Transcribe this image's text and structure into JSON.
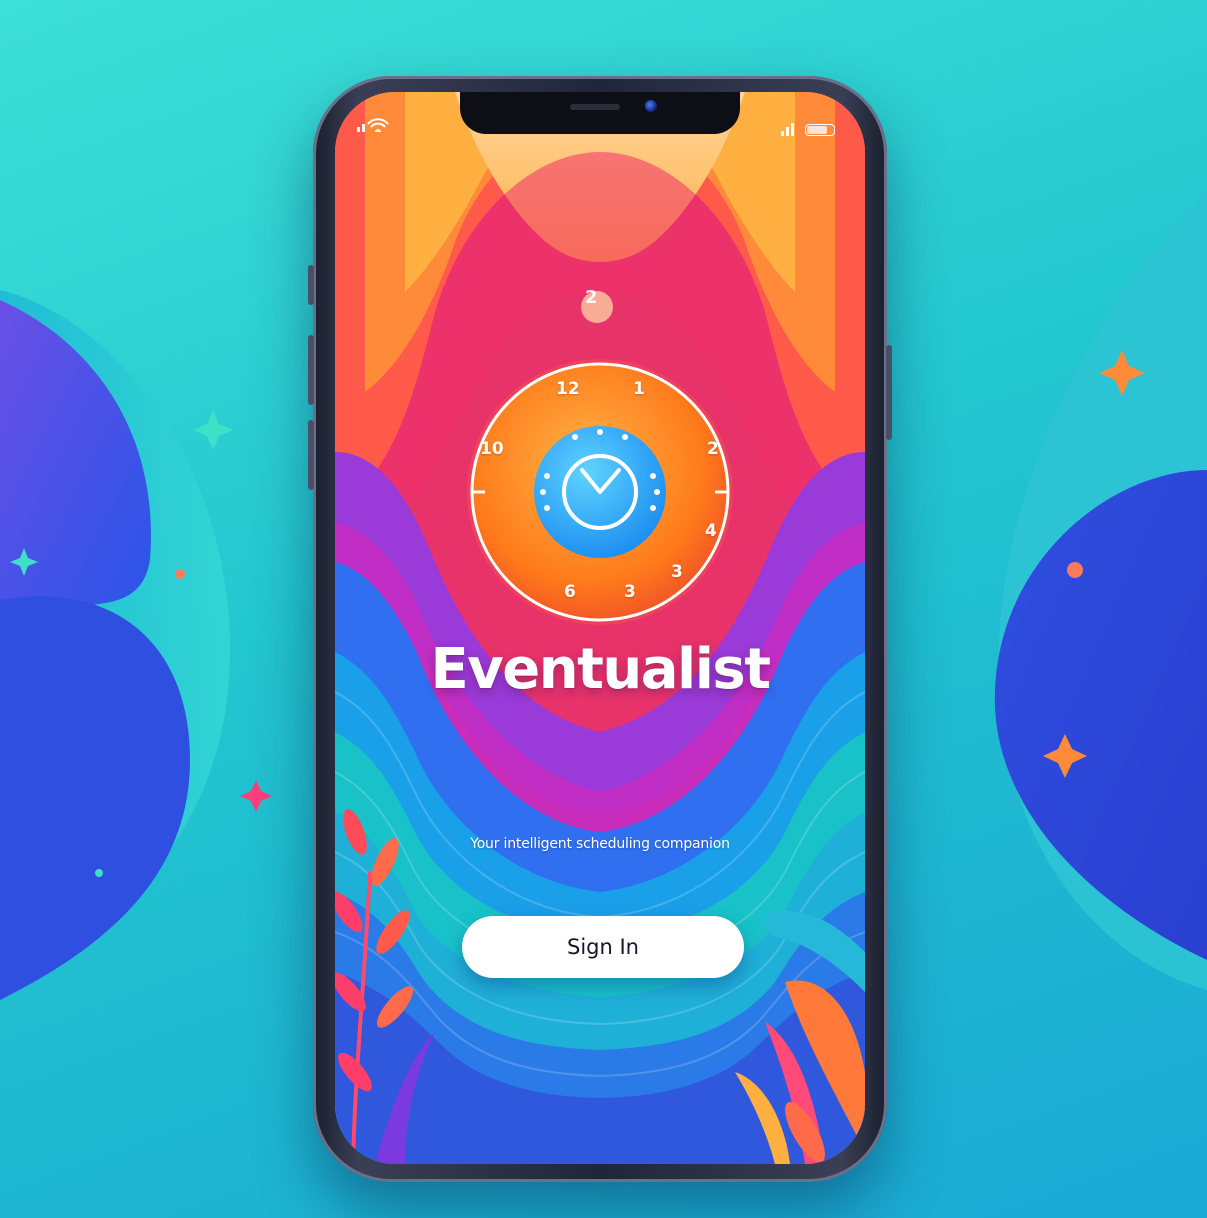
{
  "app": {
    "title": "Eventualist",
    "tagline": "Your intelligent scheduling companion"
  },
  "clock": {
    "numerals": [
      "12",
      "1",
      "2",
      "4",
      "3",
      "3",
      "6",
      "10"
    ],
    "floating_numeral": "2"
  },
  "actions": {
    "sign_in_label": "Sign In"
  },
  "status_bar": {
    "icons": [
      "wifi-icon",
      "signal-icon",
      "battery-icon"
    ]
  },
  "colors": {
    "background": "#22c6cf",
    "accent_blue": "#2f4fe0",
    "button": "#ffffff",
    "clock_face": "#ff7a1a",
    "clock_center": "#1fa8ff"
  }
}
